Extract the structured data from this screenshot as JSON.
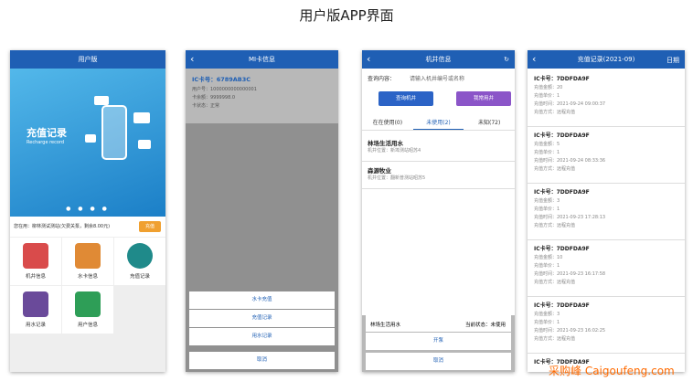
{
  "page_title": "用户版APP界面",
  "phone1": {
    "header": "用户版",
    "banner_title": "充值记录",
    "banner_subtitle": "Recharge record",
    "dots": "● ● ● ●",
    "notice": "您在用：柳林测试测站(欠费关泵，剩余8.00元)",
    "notice_button": "充值",
    "grid": [
      {
        "label": "机井信息",
        "icon": "well-icon",
        "color": "#d94b4b"
      },
      {
        "label": "水卡信息",
        "icon": "card-icon",
        "color": "#e08a35"
      },
      {
        "label": "充值记录",
        "icon": "recharge-icon",
        "color": "#1f8a8a"
      },
      {
        "label": "用水记录",
        "icon": "water-record-icon",
        "color": "#6a4a9a"
      },
      {
        "label": "用户信息",
        "icon": "gear-icon",
        "color": "#2e9e57"
      }
    ]
  },
  "phone2": {
    "header": "MI卡信息",
    "card_no": "IC卡号：6789AB3C",
    "user_no": "用户号：1000000000000001",
    "balance": "卡余额：9999998.0",
    "status": "卡状态：正常",
    "actions": [
      "水卡充值",
      "充值记录",
      "用水记录"
    ],
    "cancel": "取消"
  },
  "phone3": {
    "header": "机井信息",
    "query_label": "查询内容：",
    "query_placeholder": "请输入机井编号或名称",
    "btn_query": "查询机井",
    "btn_common": "我常用井",
    "tabs": [
      "在在使用(0)",
      "未使用(2)",
      "未知(72)"
    ],
    "wells": [
      {
        "name": "林场生活用水",
        "loc": "机井位置：新埠测站昭苏4"
      },
      {
        "name": "森源牧业",
        "loc": "机井位置：翻新普测站昭苏5"
      }
    ],
    "sheet_name": "林场生活用水",
    "sheet_state": "当前状态：未使用",
    "sheet_open": "开泵",
    "cancel": "取消"
  },
  "phone4": {
    "header": "充值记录(2021-09)",
    "right": "日期",
    "records": [
      {
        "card": "IC卡号：7DDFDA9F",
        "amount": "充值金额：20",
        "price": "充值单价：1",
        "time": "充值时间：2021-09-24 09:00:37",
        "method": "充值方式：远程充值"
      },
      {
        "card": "IC卡号：7DDFDA9F",
        "amount": "充值金额：5",
        "price": "充值单价：1",
        "time": "充值时间：2021-09-24 08:33:36",
        "method": "充值方式：远程充值"
      },
      {
        "card": "IC卡号：7DDFDA9F",
        "amount": "充值金额：3",
        "price": "充值单价：1",
        "time": "充值时间：2021-09-23 17:28:13",
        "method": "充值方式：远程充值"
      },
      {
        "card": "IC卡号：7DDFDA9F",
        "amount": "充值金额：10",
        "price": "充值单价：1",
        "time": "充值时间：2021-09-23 16:17:58",
        "method": "充值方式：远程充值"
      },
      {
        "card": "IC卡号：7DDFDA9F",
        "amount": "充值金额：3",
        "price": "充值单价：1",
        "time": "充值时间：2021-09-23 16:02:25",
        "method": "充值方式：远程充值"
      },
      {
        "card": "IC卡号：7DDFDA9F",
        "amount": "",
        "price": "",
        "time": "",
        "method": ""
      }
    ]
  },
  "watermark": "采购峰 Caigoufeng.com"
}
